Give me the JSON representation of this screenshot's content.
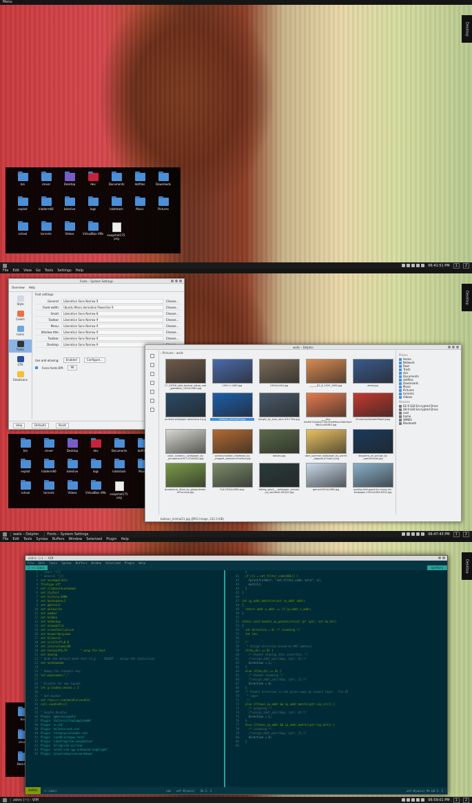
{
  "panels": [
    {
      "topbar": [
        "Menu"
      ],
      "desktop_tab": "Desktop",
      "clock": "06:41:51 PM",
      "pager": [
        "1",
        "2"
      ],
      "tasks": []
    },
    {
      "topbar": [
        "File",
        "Edit",
        "View",
        "Go",
        "Tools",
        "Settings",
        "Help"
      ],
      "desktop_tab": "Desktop",
      "clock": "06:47:43 PM",
      "pager": [
        "1",
        "2"
      ],
      "tasks": [
        "walls – Dolphin",
        "Fonts – System Settings"
      ]
    },
    {
      "topbar": [
        "File",
        "Edit",
        "Tools",
        "Syntax",
        "Buffers",
        "Window",
        "Solarized",
        "Plugin",
        "Help"
      ],
      "desktop_tab": "Desktop",
      "clock": "06:59:01 PM",
      "pager": [
        "1",
        "2"
      ],
      "tasks": [
        "zshrc (~) - VIM"
      ]
    }
  ],
  "desktop_icons": [
    {
      "label": "bin",
      "kind": "folder"
    },
    {
      "label": "clever",
      "kind": "folder"
    },
    {
      "label": "Desktop",
      "kind": "purple"
    },
    {
      "label": "dev",
      "kind": "red"
    },
    {
      "label": "Documents",
      "kind": "folder"
    },
    {
      "label": "dotfiles",
      "kind": "folder"
    },
    {
      "label": "Downloads",
      "kind": "folder"
    },
    {
      "label": "exploit",
      "kind": "folder"
    },
    {
      "label": "kladerm66",
      "kind": "folder"
    },
    {
      "label": "kdevlive",
      "kind": "folder"
    },
    {
      "label": "logs",
      "kind": "folder"
    },
    {
      "label": "lolotstash",
      "kind": "folder"
    },
    {
      "label": "Music",
      "kind": "folder"
    },
    {
      "label": "Pictures",
      "kind": "folder"
    },
    {
      "label": "school",
      "kind": "folder"
    },
    {
      "label": "torrents",
      "kind": "folder"
    },
    {
      "label": "Videos",
      "kind": "folder"
    },
    {
      "label": "VirtualBox VMs",
      "kind": "folder"
    },
    {
      "label": "snapshot175.\npng",
      "kind": "file"
    }
  ],
  "desktop_icons_2": [
    {
      "label": "bin",
      "kind": "folder"
    },
    {
      "label": "clever",
      "kind": "folder"
    },
    {
      "label": "Desktop",
      "kind": "purple"
    },
    {
      "label": "dev",
      "kind": "red"
    },
    {
      "label": "Documents",
      "kind": "folder"
    },
    {
      "label": "dotfiles",
      "kind": "folder"
    },
    {
      "label": "exploit",
      "kind": "folder"
    },
    {
      "label": "kladerm66",
      "kind": "folder"
    },
    {
      "label": "kdevlive",
      "kind": "folder"
    },
    {
      "label": "logs",
      "kind": "folder"
    },
    {
      "label": "lolotstash",
      "kind": "folder"
    },
    {
      "label": "Music",
      "kind": "folder"
    },
    {
      "label": "school",
      "kind": "folder"
    },
    {
      "label": "torrents",
      "kind": "folder"
    },
    {
      "label": "Videos",
      "kind": "folder"
    },
    {
      "label": "VirtualBox VMs",
      "kind": "folder"
    },
    {
      "label": "snapshot175.\npng",
      "kind": "file"
    }
  ],
  "fonts": {
    "title": "Fonts – System Settings",
    "toolbar": [
      "Overview",
      "Help"
    ],
    "heading": "Font settings:",
    "categories": [
      {
        "label": "Style",
        "color": "#cfd8e4"
      },
      {
        "label": "Colors",
        "color": "#e8724a"
      },
      {
        "label": "Icons",
        "color": "#6aa6e0"
      },
      {
        "label": "Fonts",
        "color": "#333333",
        "selected": true
      },
      {
        "label": "GTK",
        "color": "#2a4f9a"
      },
      {
        "label": "Emoticons",
        "color": "#f2c230"
      }
    ],
    "rows": [
      {
        "label": "General:",
        "value": "Liberation Sans Narrow 9"
      },
      {
        "label": "Fixed width:",
        "value": "Ubuntu Mono derivative Powerline 9"
      },
      {
        "label": "Small:",
        "value": "Liberation Sans Narrow 8"
      },
      {
        "label": "Toolbar:",
        "value": "Liberation Sans Narrow 9"
      },
      {
        "label": "Menu:",
        "value": "Liberation Sans Narrow 9"
      },
      {
        "label": "Window title:",
        "value": "Liberation Sans Narrow 9"
      },
      {
        "label": "Taskbar:",
        "value": "Liberation Sans Narrow 9"
      },
      {
        "label": "Desktop:",
        "value": "Liberation Sans Narrow 9"
      }
    ],
    "choose": "Choose...",
    "antialias_label": "Use anti-aliasing:",
    "antialias_value": "Enabled",
    "configure": "Configure...",
    "dpi_label": "Force fonts DPI:",
    "dpi_value": "96",
    "footer": [
      "Help",
      "Defaults",
      "Reset"
    ]
  },
  "dolphin": {
    "title": "walls – Dolphin",
    "breadcrumb": "› Pictures › walls",
    "thumbs": [
      {
        "cap": "17_03016_skat_bestow_satoa_nad\n_goesdees_1920x1080.jpg",
        "c": "#6d5a4a"
      },
      {
        "cap": "1920 x 1080.jpg",
        "c": "#4b6aa8"
      },
      {
        "cap": "1920x1440.jpg",
        "c": "#7a6b58"
      },
      {
        "cap": "______82_8_1920_1080.jpg",
        "c": "#d88a52"
      },
      {
        "cap": "abnd.jpg",
        "c": "#3a5a8a"
      },
      {
        "cap": "android-wallpaper-download-4.jpg",
        "c": "#2b4a66"
      },
      {
        "cap": "balloon_minhal21.jpg",
        "c": "#1d5ea8",
        "sel": true
      },
      {
        "cap": "berglis_by_sbre_abrs-d7h739a.jpg",
        "c": "#4a5a6a"
      },
      {
        "cap": "____big-\n9dd9074b40e0735c49e69bec55bfd3e4\n96b1cc85485.jpg",
        "c": "#e57a4e"
      },
      {
        "cap": "ChristmasSweaterPaper.jpeg",
        "c": "#c23a2e"
      },
      {
        "cap": "color_contact_r_wallpaper_by\n_johnpacono327-d7u8x81j.jpg",
        "c": "#d8d8d0"
      },
      {
        "cap": "communication_timebase_by\n_moguel_zambra-d7xw9ce.jpg",
        "c": "#b06a32"
      },
      {
        "cap": "daisies.jpg",
        "c": "#5a6a4a"
      },
      {
        "cap": "dark_summer_wallpaper_by_pierre\n_legarde-d7xqln1.png",
        "c": "#e8c060"
      },
      {
        "cap": "diagrams_of_grunge_by\n_speckhauler.jpg",
        "c": "#1a3a5a"
      },
      {
        "cap": "dreamland_4free_by_gregsnlecke-\nd7hvnnnw.jpg",
        "c": "#7a9a4a"
      },
      {
        "cap": "Full-1920x1080.png",
        "c": "#7a8a6a"
      },
      {
        "cap": "falling_sport___wallpaper_version\n_by_sambrell-d5l1j2t.jpg",
        "c": "#2a3a3a"
      },
      {
        "cap": "gemini1920x1080.jpg",
        "c": "#c8d8e8"
      },
      {
        "cap": "gorillaz-feel-good-inc-music-hd-\nwallpaper-1920x1080-6352.jpg",
        "c": "#8ab0c8"
      }
    ],
    "places_header": "Places",
    "places": [
      "Home",
      "Network",
      "Root",
      "Trash",
      "dev",
      "Documents",
      "dotfiles",
      "Downloads",
      "Music",
      "Pictures",
      "torrents",
      "Videos"
    ],
    "devices_header": "Devices",
    "devices": [
      "62.9 GiB Encrypted Drive",
      "48.9 GiB Encrypted Drive",
      "root",
      "home",
      "WIN81",
      "Bluetooth"
    ],
    "status": "balloon_minhal21.jpg (JPEG Image, 232.3 KiB)"
  },
  "vim": {
    "title": "zshrc (~) - VIM",
    "menu": [
      "File",
      "Edit",
      "Tools",
      "Syntax",
      "Buffers",
      "Window",
      "Solarized",
      "Plugin",
      "Help"
    ],
    "tab": "1 ~/.vimrc",
    "tab_right": "buffers",
    "left_lines": [
      [
        "1",
        "\" vimrc \"{{{"
      ],
      [
        "2",
        "\" General \"{{{"
      ],
      [
        "3",
        "set nocompatible"
      ],
      [
        "4",
        "filetype off"
      ],
      [
        "5",
        "set clipboard=unnamed"
      ],
      [
        "6",
        "set ttyfast"
      ],
      [
        "7",
        "set history=1000"
      ],
      [
        "8",
        "set backspace=2"
      ],
      [
        "9",
        "set gdefault"
      ],
      [
        "10",
        "set autowrite"
      ],
      [
        "11",
        "set number"
      ],
      [
        "12",
        "set hidden"
      ],
      [
        "13",
        "set nobackup"
      ],
      [
        "14",
        "set noswapfile"
      ],
      [
        "15",
        "set visualbell=bisch"
      ],
      [
        "16",
        "set keywordprg=man"
      ],
      [
        "17",
        "set hlsearch"
      ],
      [
        "18",
        "set scrolloff=0 8"
      ],
      [
        "19",
        "set colorcolumn=80"
      ],
      [
        "20",
        "set textwidth=79        \" wrap the text"
      ],
      [
        "21",
        "set nowrap"
      ],
      [
        "22",
        "\" Hide the default mode text (e.g. -- INSERT -- below the statusline)"
      ],
      [
        "23",
        "set noshowmode"
      ],
      [
        "24",
        ""
      ],
      [
        "25",
        "\" Remap the <leader> key"
      ],
      [
        "26",
        "let mapleader=\",\""
      ],
      [
        "27",
        ""
      ],
      [
        "28",
        "\" Disable for new layout"
      ],
      [
        "29",
        "let g:loaded_sensei = 1"
      ],
      [
        "30",
        ""
      ],
      [
        "31",
        "\" Set bundle"
      ],
      [
        "32",
        "set rtp+=~/.vim/bundle/vundle/"
      ],
      [
        "33",
        "call vundle#rc()"
      ],
      [
        "34",
        ""
      ],
      [
        "35",
        "\" Vundle Bundles"
      ],
      [
        "36",
        "Plugin 'gmarik/vundle'"
      ],
      [
        "37",
        "Plugin 'Valloric/YouCompleteMe'"
      ],
      [
        "38",
        "Plugin 'a.vim'"
      ],
      [
        "39",
        "Plugin 'mileszs/ack.vim'"
      ],
      [
        "40",
        "Plugin 'itchyny/calendar.vim'"
      ],
      [
        "41",
        "Plugin 'cyndk/octopus-term'"
      ],
      [
        "42",
        "Plugin 'Lokaltog/vim-easymotion'"
      ],
      [
        "43",
        "Plugin 'bling/vim-airline'"
      ],
      [
        "44",
        "Plugin 'octol/vim-cpp-enhanced-highlight'"
      ],
      [
        "45",
        "Plugin 'plasticboy/vim-markdown'"
      ]
    ],
    "right_lines": [
      [
        "",
        "  }"
      ],
      [
        "41",
        "  if ((s = set_filter_code(HOL)) {"
      ],
      [
        "42",
        "    fprintf(stderr, \"set_filter_code: %s\\n\", s);"
      ],
      [
        "43",
        "    exit(1);"
      ],
      [
        "44",
        "  }"
      ],
      [
        "45",
        "}"
      ],
      [
        "46",
        ""
      ],
      [
        "47",
        "int ip_addr_match(struct in_addr addr)"
      ],
      [
        "48",
        "{"
      ],
      [
        "49",
        "  return addr.s_addr == if_ip_addr.s_addr;"
      ],
      [
        "50",
        "}"
      ],
      [
        "51",
        ""
      ],
      [
        "52",
        "static void handle_ip_packet(struct ip* iptr, int hw_dir)"
      ],
      [
        "53",
        "{"
      ],
      [
        "54",
        "  int direction = 0; /* incoming */"
      ],
      [
        "55",
        "  int len;"
      ],
      [
        "56",
        ""
      ],
      [
        "57",
        "  /*"
      ],
      [
        "58",
        "   * Assign direction based on MAC address"
      ],
      [
        "59",
        "  if(hw_dir == 0) {"
      ],
      [
        "60",
        "    /* Packet leaving this interface. */"
      ],
      [
        "61",
        "    /*assign_addr_pair(&ap, iptr, 0);*/"
      ],
      [
        "62",
        "    direction = 1;"
      ],
      [
        "63",
        "  }"
      ],
      [
        "64",
        "  else if(hw_dir == 0) {"
      ],
      [
        "65",
        "    /* Packet incoming */"
      ],
      [
        "66",
        "    /*assign_addr_pair(&ap, iptr, 1);*/"
      ],
      [
        "67",
        "    direction = 0;"
      ],
      [
        "68",
        "  }"
      ],
      [
        "69",
        "  /* Packet direction is not given away by h/ware layer.  Try IP"
      ],
      [
        "70",
        "   * layer"
      ],
      [
        "71",
        "   */"
      ],
      [
        "72",
        "  else if(have_ip_addr && ip_addr_match(iptr->ip_src)) {"
      ],
      [
        "73",
        "    /* outgoing */"
      ],
      [
        "74",
        "    /*assign_addr_pair(&ap, iptr, 0);*/"
      ],
      [
        "75",
        "    direction = 1;"
      ],
      [
        "76",
        "  }"
      ],
      [
        "77",
        "  else if(have_ip_addr && ip_addr_match(iptr->ip_dst)) {"
      ],
      [
        "78",
        "    /* incoming */"
      ],
      [
        "79",
        "    /*assign_addr_pair(&ap, iptr, 1);*/"
      ],
      [
        "80",
        "    direction = 0;"
      ],
      [
        "81",
        "  }"
      ],
      [
        "82",
        ""
      ]
    ],
    "status_mode": "NORMAL",
    "status_file": "~/.vimrc",
    "status_ft": "vim",
    "status_enc": "utf-8[unix]",
    "status_pos": "3%  1:  1",
    "status_right": "utf-8[unix]   9%  LN   1:  1"
  },
  "colors": {
    "accent": "#2aa198",
    "folder": "#4c8fd6",
    "selection": "#3a8ee6"
  }
}
